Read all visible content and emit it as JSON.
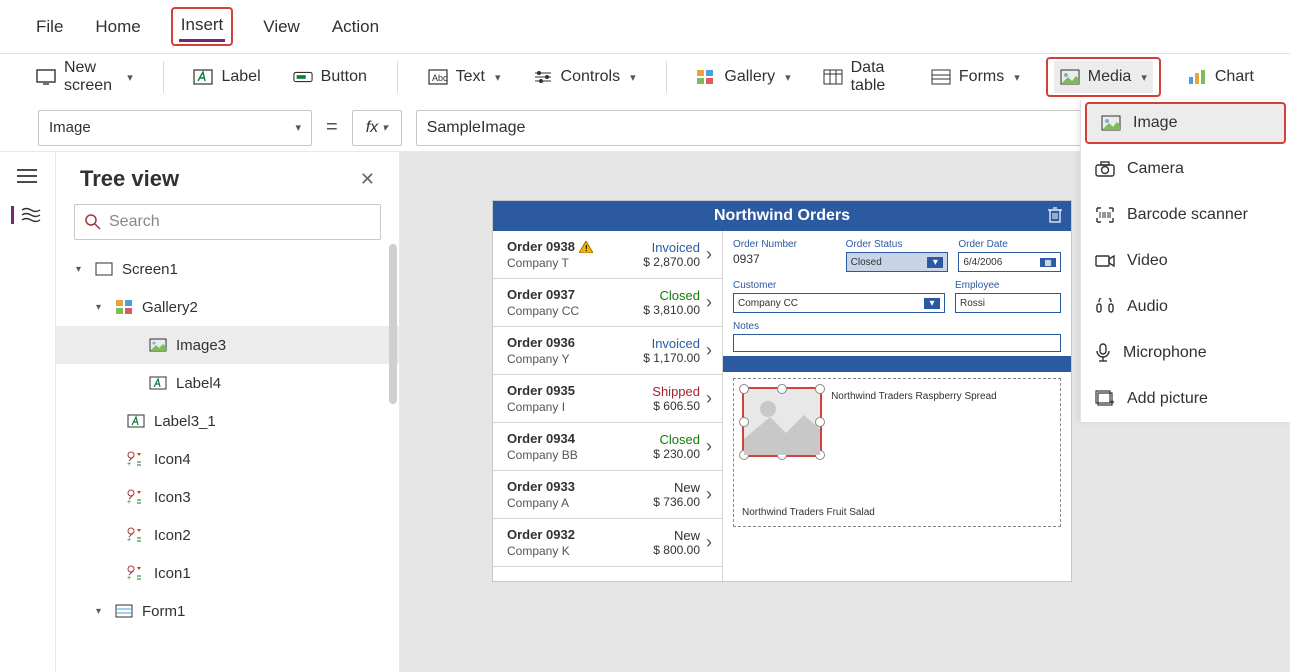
{
  "menubar": {
    "file": "File",
    "home": "Home",
    "insert": "Insert",
    "view": "View",
    "action": "Action"
  },
  "ribbon": {
    "new_screen": "New screen",
    "label": "Label",
    "button": "Button",
    "text": "Text",
    "controls": "Controls",
    "gallery": "Gallery",
    "data_table": "Data table",
    "forms": "Forms",
    "media": "Media",
    "chart": "Chart"
  },
  "formula": {
    "property": "Image",
    "value": "SampleImage"
  },
  "tree": {
    "title": "Tree view",
    "search_placeholder": "Search",
    "items": {
      "screen1": "Screen1",
      "gallery2": "Gallery2",
      "image3": "Image3",
      "label4": "Label4",
      "label3_1": "Label3_1",
      "icon4": "Icon4",
      "icon3": "Icon3",
      "icon2": "Icon2",
      "icon1": "Icon1",
      "form1": "Form1"
    }
  },
  "app": {
    "title": "Northwind Orders",
    "orders": [
      {
        "num": "Order 0938",
        "company": "Company T",
        "status": "Invoiced",
        "status_cls": "invoiced",
        "price": "$ 2,870.00",
        "warn": true
      },
      {
        "num": "Order 0937",
        "company": "Company CC",
        "status": "Closed",
        "status_cls": "closed",
        "price": "$ 3,810.00"
      },
      {
        "num": "Order 0936",
        "company": "Company Y",
        "status": "Invoiced",
        "status_cls": "invoiced",
        "price": "$ 1,170.00"
      },
      {
        "num": "Order 0935",
        "company": "Company I",
        "status": "Shipped",
        "status_cls": "shipped",
        "price": "$ 606.50"
      },
      {
        "num": "Order 0934",
        "company": "Company BB",
        "status": "Closed",
        "status_cls": "closed",
        "price": "$ 230.00"
      },
      {
        "num": "Order 0933",
        "company": "Company A",
        "status": "New",
        "status_cls": "new",
        "price": "$ 736.00"
      },
      {
        "num": "Order 0932",
        "company": "Company K",
        "status": "New",
        "status_cls": "new",
        "price": "$ 800.00"
      }
    ],
    "detail": {
      "order_number_label": "Order Number",
      "order_number": "0937",
      "order_status_label": "Order Status",
      "order_status": "Closed",
      "order_date_label": "Order Date",
      "order_date": "6/4/2006",
      "customer_label": "Customer",
      "customer": "Company CC",
      "employee_label": "Employee",
      "employee": "Rossi",
      "notes_label": "Notes",
      "product1": "Northwind Traders Raspberry Spread",
      "product2": "Northwind Traders Fruit Salad"
    }
  },
  "media_menu": {
    "image": "Image",
    "camera": "Camera",
    "barcode": "Barcode scanner",
    "video": "Video",
    "audio": "Audio",
    "microphone": "Microphone",
    "add_picture": "Add picture"
  }
}
